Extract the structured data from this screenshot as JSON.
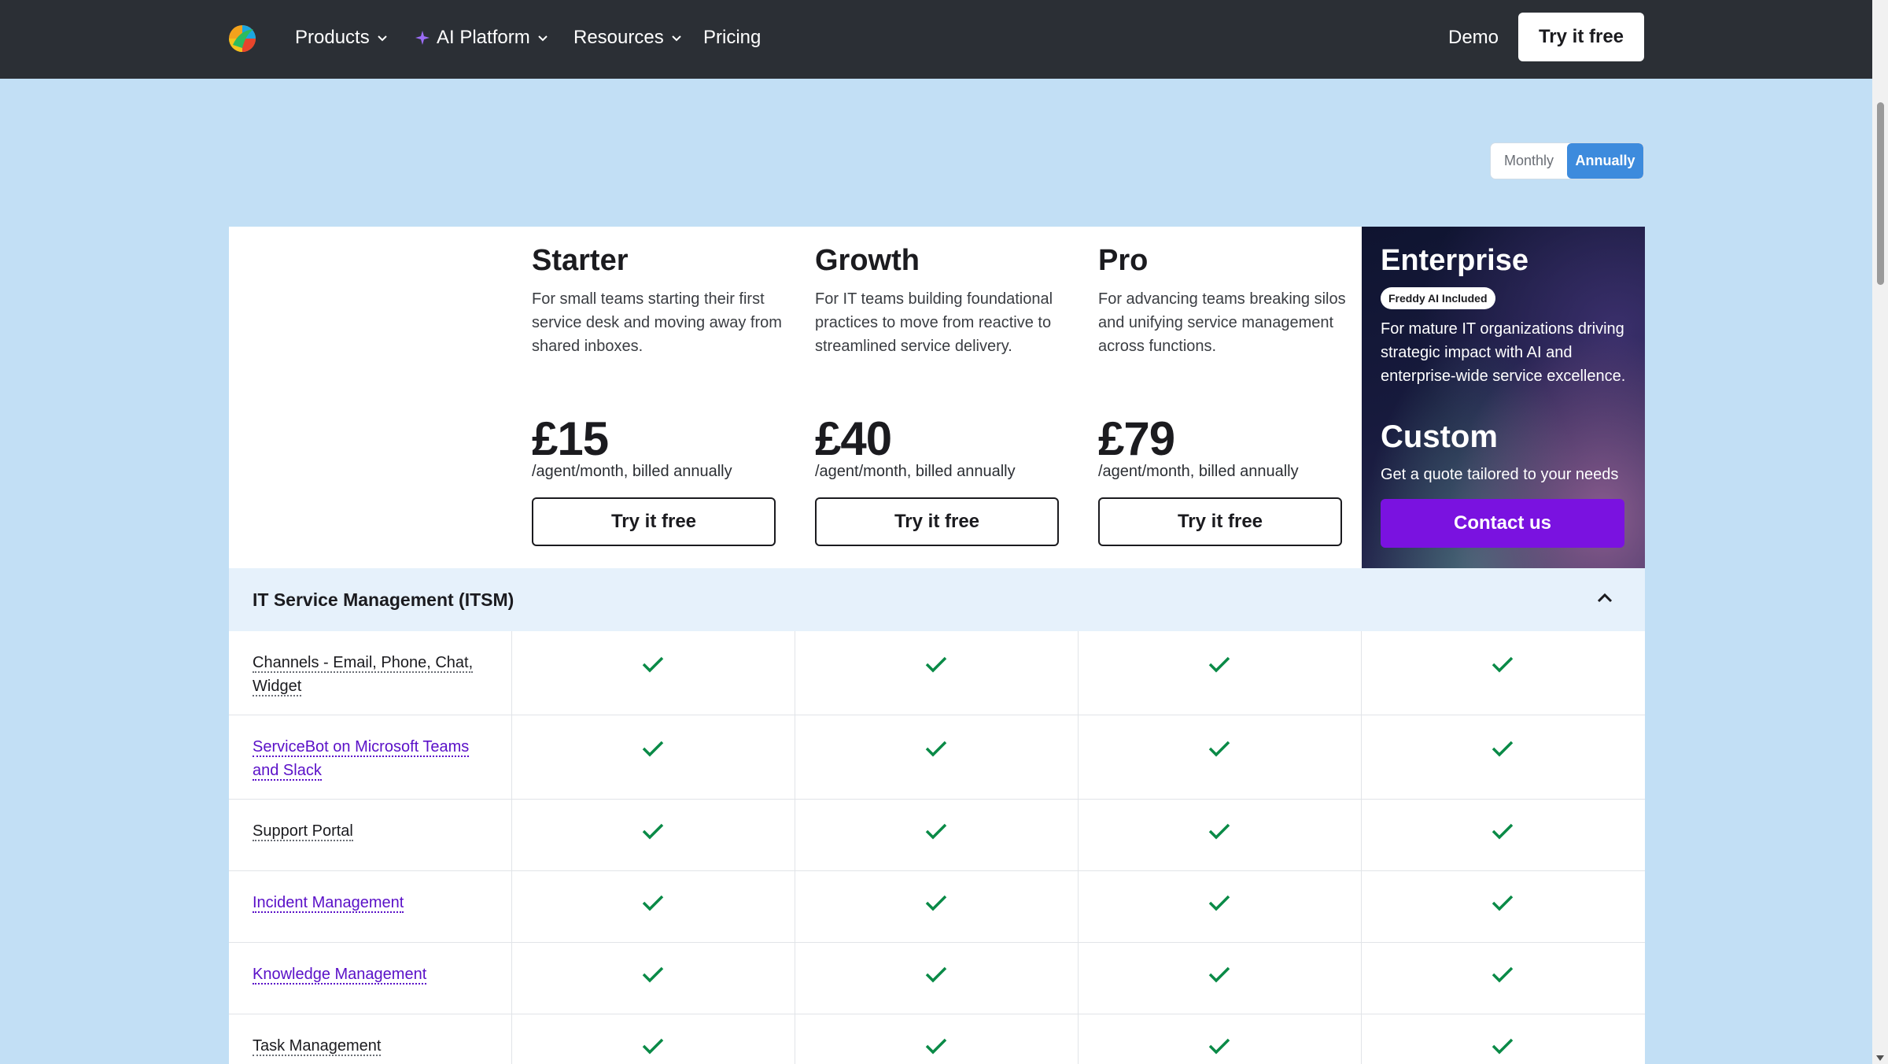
{
  "nav": {
    "items": [
      {
        "label": "Products",
        "has_dropdown": true
      },
      {
        "label": "AI Platform",
        "has_dropdown": true,
        "icon": "sparkle-icon"
      },
      {
        "label": "Resources",
        "has_dropdown": true
      },
      {
        "label": "Pricing",
        "has_dropdown": false
      }
    ],
    "demo": "Demo",
    "try": "Try it free"
  },
  "billing_toggle": {
    "options": [
      "Monthly",
      "Annually"
    ],
    "selected": "Annually"
  },
  "plans": [
    {
      "name": "Starter",
      "description": "For small teams starting their first service desk and moving away from shared inboxes.",
      "price": "£15",
      "billing": "/agent/month, billed annually",
      "cta": "Try it free"
    },
    {
      "name": "Growth",
      "description": "For IT teams building foundational practices to move from reactive to streamlined service delivery.",
      "price": "£40",
      "billing": "/agent/month, billed annually",
      "cta": "Try it free"
    },
    {
      "name": "Pro",
      "description": "For advancing teams breaking silos and unifying service management across functions.",
      "price": "£79",
      "billing": "/agent/month, billed annually",
      "cta": "Try it free"
    }
  ],
  "enterprise": {
    "name": "Enterprise",
    "badge": "Freddy AI Included",
    "description": "For mature IT organizations driving strategic impact with AI and enterprise-wide service excellence.",
    "price": "Custom",
    "billing": "Get a quote tailored to your needs",
    "cta": "Contact us"
  },
  "section": {
    "title": "IT Service Management (ITSM)",
    "expanded": true
  },
  "features": [
    {
      "label": "Channels - Email, Phone, Chat, Widget",
      "link": false,
      "included": [
        true,
        true,
        true,
        true
      ]
    },
    {
      "label": "ServiceBot on Microsoft Teams and Slack",
      "link": true,
      "included": [
        true,
        true,
        true,
        true
      ]
    },
    {
      "label": "Support Portal",
      "link": false,
      "included": [
        true,
        true,
        true,
        true
      ]
    },
    {
      "label": "Incident Management",
      "link": true,
      "included": [
        true,
        true,
        true,
        true
      ]
    },
    {
      "label": "Knowledge Management",
      "link": true,
      "included": [
        true,
        true,
        true,
        true
      ]
    },
    {
      "label": "Task Management",
      "link": false,
      "included": [
        true,
        true,
        true,
        true
      ]
    }
  ],
  "colors": {
    "page_bg": "#c2dff5",
    "nav_bg": "#2b2f35",
    "accent_purple": "#7a12e0",
    "toggle_active": "#3d8bdd",
    "check_green": "#0a8a47",
    "link_purple": "#5a10c8"
  }
}
